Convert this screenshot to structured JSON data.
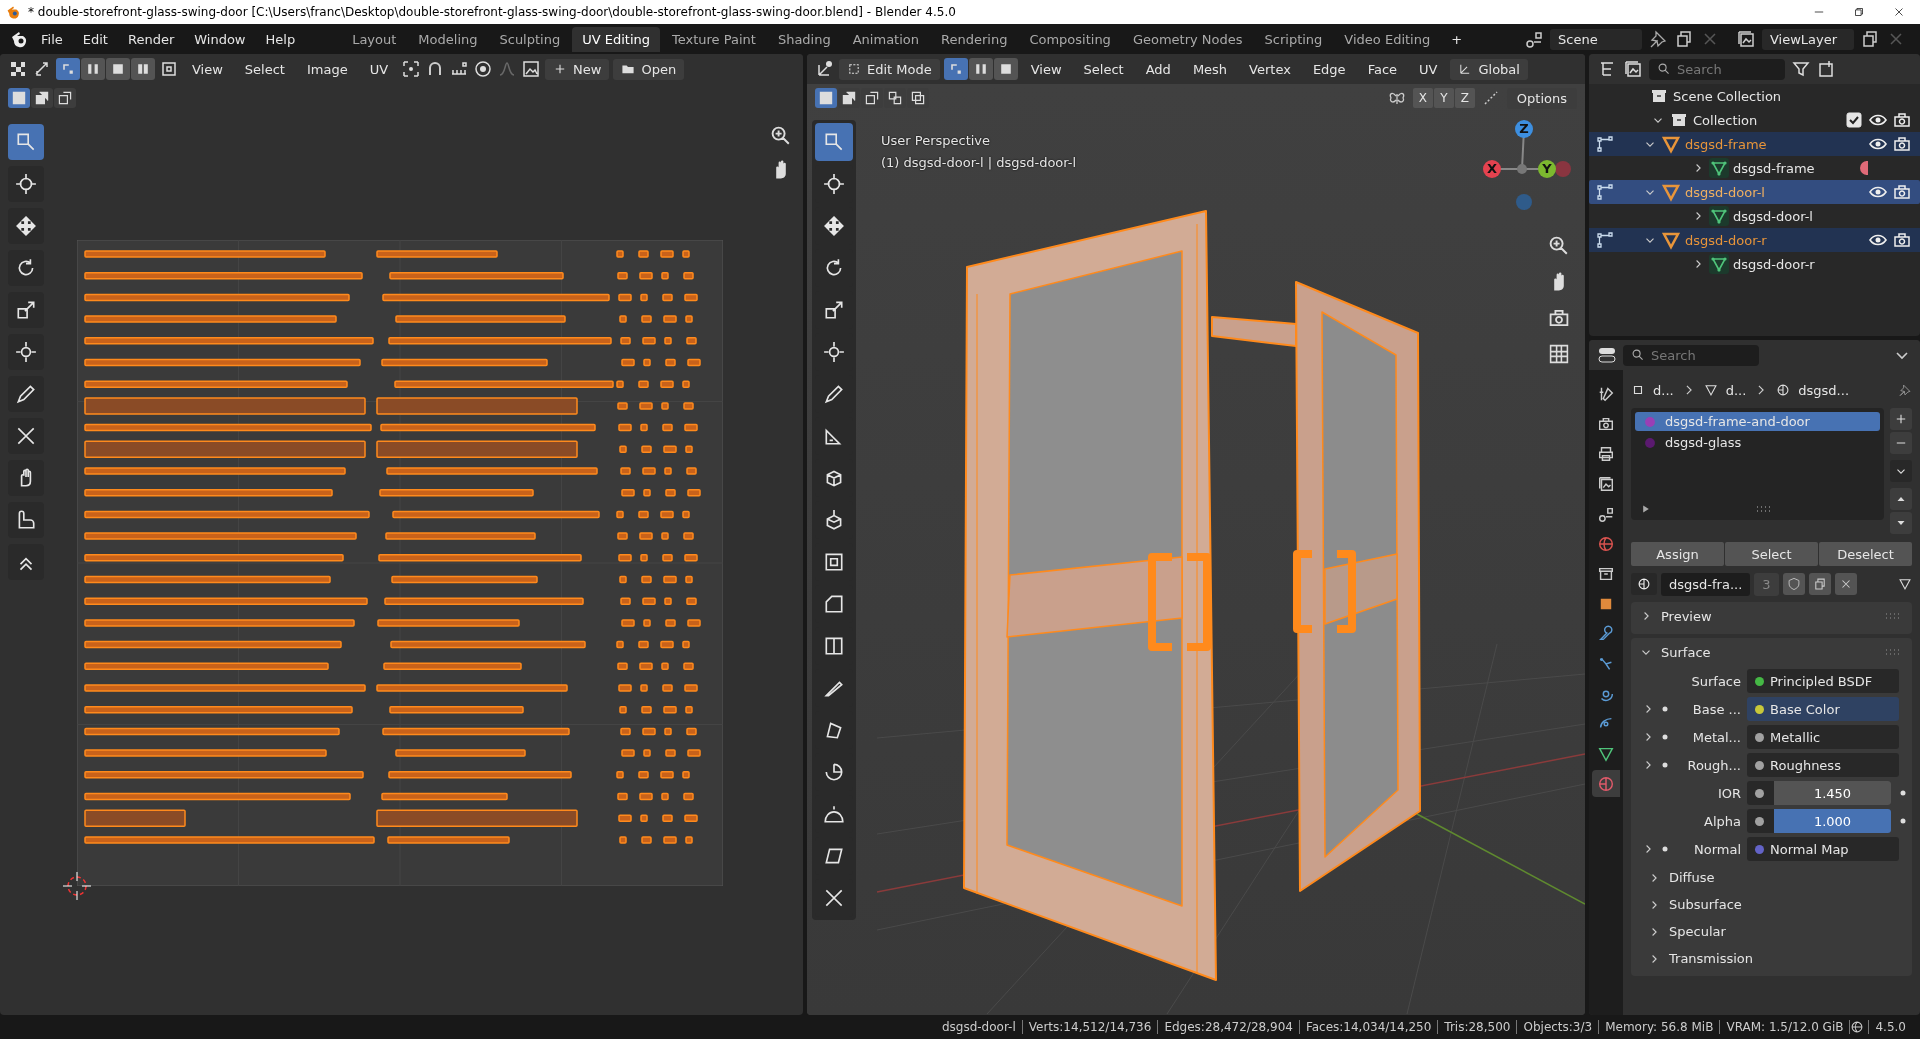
{
  "window": {
    "title": "* double-storefront-glass-swing-door [C:\\Users\\franc\\Desktop\\double-storefront-glass-swing-door\\double-storefront-glass-swing-door.blend] - Blender 4.5.0"
  },
  "menu": [
    "File",
    "Edit",
    "Render",
    "Window",
    "Help"
  ],
  "workspaces": [
    {
      "label": "Layout",
      "selected": false
    },
    {
      "label": "Modeling",
      "selected": false
    },
    {
      "label": "Sculpting",
      "selected": false
    },
    {
      "label": "UV Editing",
      "selected": true
    },
    {
      "label": "Texture Paint",
      "selected": false
    },
    {
      "label": "Shading",
      "selected": false
    },
    {
      "label": "Animation",
      "selected": false
    },
    {
      "label": "Rendering",
      "selected": false
    },
    {
      "label": "Compositing",
      "selected": false
    },
    {
      "label": "Geometry Nodes",
      "selected": false
    },
    {
      "label": "Scripting",
      "selected": false
    },
    {
      "label": "Video Editing",
      "selected": false
    }
  ],
  "add_workspace": "+",
  "scene": "Scene",
  "view_layer": "ViewLayer",
  "uv_editor": {
    "menus": [
      "View",
      "Select",
      "Image",
      "UV"
    ],
    "new_label": "New",
    "open_label": "Open",
    "select_modes": [
      {
        "kind": "vertex",
        "selected": true
      },
      {
        "kind": "edge",
        "selected": false
      },
      {
        "kind": "face",
        "selected": false
      },
      {
        "kind": "island",
        "selected": false
      }
    ],
    "selection_ops": [
      {
        "kind": "set",
        "selected": true
      },
      {
        "kind": "extend",
        "selected": false
      },
      {
        "kind": "subtract",
        "selected": false
      }
    ],
    "tools": [
      {
        "kind": "select",
        "selected": true
      },
      {
        "kind": "cursor",
        "selected": false
      },
      {
        "kind": "move",
        "selected": false
      },
      {
        "kind": "rotate",
        "selected": false
      },
      {
        "kind": "scale",
        "selected": false
      },
      {
        "kind": "transform",
        "selected": false
      },
      {
        "kind": "annotate",
        "selected": false
      },
      {
        "kind": "rip",
        "selected": false
      },
      {
        "kind": "grab",
        "selected": false
      },
      {
        "kind": "relax",
        "selected": false
      },
      {
        "kind": "pinch",
        "selected": false
      }
    ]
  },
  "viewport": {
    "mode": "Edit Mode",
    "menus": [
      "View",
      "Select",
      "Add",
      "Mesh",
      "Vertex",
      "Edge",
      "Face",
      "UV"
    ],
    "orientation": "Global",
    "mirror_axes": [
      "X",
      "Y",
      "Z"
    ],
    "options": "Options",
    "view_name": "User Perspective",
    "object_line": "(1) dsgsd-door-l | dsgsd-door-l",
    "select_modes": [
      {
        "kind": "vertex",
        "selected": true
      },
      {
        "kind": "edge",
        "selected": false
      },
      {
        "kind": "face",
        "selected": false
      }
    ],
    "selection_ops": [
      {
        "kind": "set",
        "selected": true
      },
      {
        "kind": "extend",
        "selected": false
      },
      {
        "kind": "subtract",
        "selected": false
      },
      {
        "kind": "invert",
        "selected": false
      },
      {
        "kind": "intersect",
        "selected": false
      }
    ],
    "gizmo": [
      {
        "label": "X",
        "color": "#e5424f"
      },
      {
        "label": "Y",
        "color": "#7cb82f"
      },
      {
        "label": "Z",
        "color": "#3d8fe0"
      }
    ],
    "tools": [
      {
        "kind": "select",
        "selected": true
      },
      {
        "kind": "cursor",
        "selected": false
      },
      {
        "kind": "move",
        "selected": false
      },
      {
        "kind": "rotate",
        "selected": false
      },
      {
        "kind": "scale",
        "selected": false
      },
      {
        "kind": "transform",
        "selected": false
      },
      {
        "kind": "annotate",
        "selected": false
      },
      {
        "kind": "measure",
        "selected": false
      },
      {
        "kind": "add_cube",
        "selected": false
      },
      {
        "kind": "extrude",
        "selected": false
      },
      {
        "kind": "inset",
        "selected": false
      },
      {
        "kind": "bevel",
        "selected": false
      },
      {
        "kind": "loop_cut",
        "selected": false
      },
      {
        "kind": "knife",
        "selected": false
      },
      {
        "kind": "poly_build",
        "selected": false
      },
      {
        "kind": "spin",
        "selected": false
      },
      {
        "kind": "smooth",
        "selected": false
      },
      {
        "kind": "shear",
        "selected": false
      },
      {
        "kind": "rip",
        "selected": false
      }
    ]
  },
  "outliner": {
    "search_placeholder": "Search",
    "tree": [
      {
        "label": "Scene Collection",
        "kind": "scene_collection",
        "children": [
          {
            "label": "Collection",
            "kind": "collection",
            "expanded": true,
            "checked": true,
            "children": [
              {
                "label": "dsgsd-frame",
                "kind": "object",
                "expanded": true,
                "selected": true,
                "active": false,
                "children": [
                  {
                    "label": "dsgsd-frame",
                    "kind": "mesh",
                    "expanded": false,
                    "material_icon": true
                  }
                ]
              },
              {
                "label": "dsgsd-door-l",
                "kind": "object",
                "expanded": true,
                "selected": true,
                "active": true,
                "children": [
                  {
                    "label": "dsgsd-door-l",
                    "kind": "mesh",
                    "expanded": false,
                    "material_icon": false
                  }
                ]
              },
              {
                "label": "dsgsd-door-r",
                "kind": "object",
                "expanded": true,
                "selected": true,
                "active": false,
                "children": [
                  {
                    "label": "dsgsd-door-r",
                    "kind": "mesh",
                    "expanded": false,
                    "material_icon": false
                  }
                ]
              }
            ]
          }
        ]
      }
    ]
  },
  "properties": {
    "search_placeholder": "Search",
    "tabs": [
      {
        "kind": "tool",
        "selected": false
      },
      {
        "kind": "render",
        "selected": false
      },
      {
        "kind": "output",
        "selected": false
      },
      {
        "kind": "view_layer",
        "selected": false
      },
      {
        "kind": "scene",
        "selected": false
      },
      {
        "kind": "world",
        "selected": false
      },
      {
        "kind": "collection",
        "selected": false
      },
      {
        "kind": "object",
        "selected": false
      },
      {
        "kind": "modifier",
        "selected": false
      },
      {
        "kind": "particles",
        "selected": false
      },
      {
        "kind": "physics",
        "selected": false
      },
      {
        "kind": "constraints",
        "selected": false
      },
      {
        "kind": "data",
        "selected": false
      },
      {
        "kind": "material",
        "selected": true
      }
    ],
    "breadcrumb": [
      "d...",
      "d...",
      "dsgsd..."
    ],
    "material_slots": [
      {
        "name": "dsgsd-frame-and-door",
        "selected": true
      },
      {
        "name": "dsgsd-glass",
        "selected": false
      }
    ],
    "slot_actions": [
      "Assign",
      "Select",
      "Deselect"
    ],
    "material": {
      "name": "dsgsd-fra...",
      "users": "3"
    },
    "panels": [
      {
        "title": "Preview",
        "expanded": false
      },
      {
        "title": "Surface",
        "expanded": true
      }
    ],
    "surface_rows": [
      {
        "kind": "link",
        "label": "Surface",
        "value": "Principled BSDF",
        "color": "#45b845",
        "expandable": false,
        "highlighted": false
      },
      {
        "kind": "link",
        "label": "Base ...",
        "value": "Base Color",
        "color": "#c8c83a",
        "expandable": true,
        "highlighted": true
      },
      {
        "kind": "link",
        "label": "Metal...",
        "value": "Metallic",
        "color": "#a1a1a1",
        "expandable": true,
        "highlighted": false
      },
      {
        "kind": "link",
        "label": "Rough...",
        "value": "Roughness",
        "color": "#a1a1a1",
        "expandable": true,
        "highlighted": false
      },
      {
        "kind": "number",
        "label": "IOR",
        "value": "1.450",
        "color": "#a1a1a1",
        "expandable": false,
        "highlighted": false
      },
      {
        "kind": "number",
        "label": "Alpha",
        "value": "1.000",
        "color": "#a1a1a1",
        "expandable": false,
        "highlighted": true
      },
      {
        "kind": "link",
        "label": "Normal",
        "value": "Normal Map",
        "color": "#6363c7",
        "expandable": true,
        "highlighted": false
      }
    ],
    "subpanels": [
      {
        "title": "Diffuse",
        "expanded": false
      },
      {
        "title": "Subsurface",
        "expanded": false
      },
      {
        "title": "Specular",
        "expanded": false
      },
      {
        "title": "Transmission",
        "expanded": false
      }
    ]
  },
  "status_bar": {
    "items": [
      "dsgsd-door-l",
      "Verts:14,512/14,736",
      "Edges:28,472/28,904",
      "Faces:14,034/14,250",
      "Tris:28,500",
      "Objects:3/3",
      "Memory: 56.8 MiB",
      "VRAM: 1.5/12.0 GiB"
    ],
    "version": "4.5.0"
  }
}
